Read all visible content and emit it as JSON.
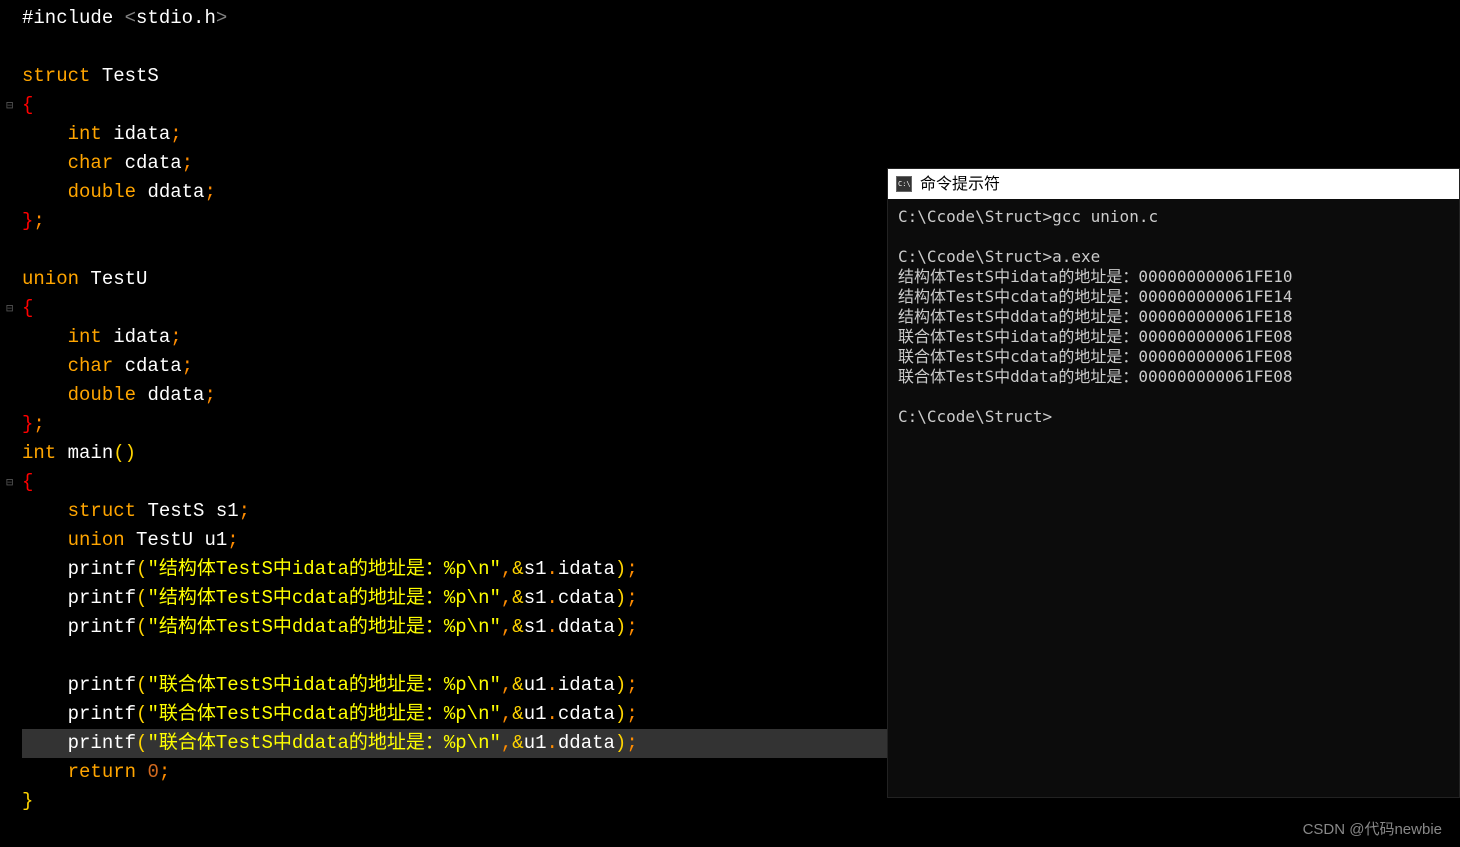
{
  "code": {
    "lines": [
      {
        "type": "include",
        "raw": "#include <stdio.h>"
      },
      {
        "type": "blank"
      },
      {
        "type": "struct_decl",
        "kw": "struct",
        "name": "TestS"
      },
      {
        "type": "open_brace",
        "fold": true
      },
      {
        "type": "member",
        "indent": "    ",
        "kw": "int",
        "name": "idata"
      },
      {
        "type": "member",
        "indent": "    ",
        "kw": "char",
        "name": "cdata"
      },
      {
        "type": "member",
        "indent": "    ",
        "kw": "double",
        "name": "ddata"
      },
      {
        "type": "close_brace_semi"
      },
      {
        "type": "blank"
      },
      {
        "type": "struct_decl",
        "kw": "union",
        "name": "TestU"
      },
      {
        "type": "open_brace",
        "fold": true
      },
      {
        "type": "member",
        "indent": "    ",
        "kw": "int",
        "name": "idata"
      },
      {
        "type": "member",
        "indent": "    ",
        "kw": "char",
        "name": "cdata"
      },
      {
        "type": "member",
        "indent": "    ",
        "kw": "double",
        "name": "ddata"
      },
      {
        "type": "close_brace_semi"
      },
      {
        "type": "main_decl",
        "ret": "int",
        "name": "main"
      },
      {
        "type": "open_brace",
        "fold": true
      },
      {
        "type": "vardecl",
        "indent": "    ",
        "kw": "struct",
        "typ": "TestS",
        "name": "s1"
      },
      {
        "type": "vardecl",
        "indent": "    ",
        "kw": "union",
        "typ": "TestU",
        "name": "u1"
      },
      {
        "type": "printf",
        "indent": "    ",
        "str": "\"结构体TestS中idata的地址是：%p\\n\"",
        "obj": "s1",
        "field": "idata"
      },
      {
        "type": "printf",
        "indent": "    ",
        "str": "\"结构体TestS中cdata的地址是：%p\\n\"",
        "obj": "s1",
        "field": "cdata"
      },
      {
        "type": "printf",
        "indent": "    ",
        "str": "\"结构体TestS中ddata的地址是：%p\\n\"",
        "obj": "s1",
        "field": "ddata"
      },
      {
        "type": "blank"
      },
      {
        "type": "printf",
        "indent": "    ",
        "str": "\"联合体TestS中idata的地址是：%p\\n\"",
        "obj": "u1",
        "field": "idata"
      },
      {
        "type": "printf",
        "indent": "    ",
        "str": "\"联合体TestS中cdata的地址是：%p\\n\"",
        "obj": "u1",
        "field": "cdata"
      },
      {
        "type": "printf",
        "indent": "    ",
        "str": "\"联合体TestS中ddata的地址是：%p\\n\"",
        "obj": "u1",
        "field": "ddata",
        "highlight": true
      },
      {
        "type": "return",
        "indent": "    ",
        "val": "0"
      },
      {
        "type": "close_brace_y"
      }
    ]
  },
  "fold_char": "⊟",
  "cmd": {
    "title": "命令提示符",
    "lines": [
      "C:\\Ccode\\Struct>gcc union.c",
      "",
      "C:\\Ccode\\Struct>a.exe",
      "结构体TestS中idata的地址是：000000000061FE10",
      "结构体TestS中cdata的地址是：000000000061FE14",
      "结构体TestS中ddata的地址是：000000000061FE18",
      "联合体TestS中idata的地址是：000000000061FE08",
      "联合体TestS中cdata的地址是：000000000061FE08",
      "联合体TestS中ddata的地址是：000000000061FE08",
      "",
      "C:\\Ccode\\Struct>"
    ]
  },
  "watermark": "CSDN @代码newbie"
}
